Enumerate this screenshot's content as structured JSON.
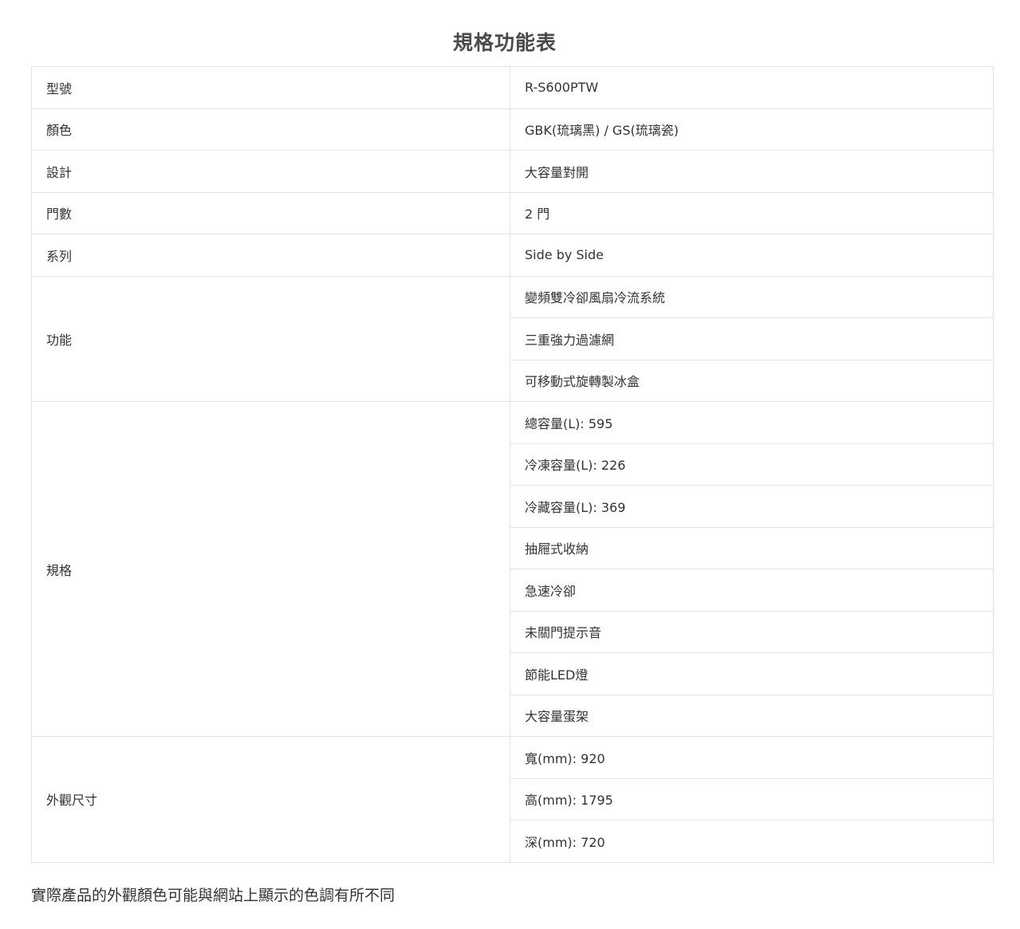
{
  "title": "規格功能表",
  "spec": {
    "model": {
      "label": "型號",
      "value": "R-S600PTW"
    },
    "color": {
      "label": "顏色",
      "value": "GBK(琉璃黑) / GS(琉璃瓷)"
    },
    "design": {
      "label": "設計",
      "value": "大容量對開"
    },
    "doors": {
      "label": "門數",
      "value": "2 門"
    },
    "series": {
      "label": "系列",
      "value": "Side by Side"
    },
    "features": {
      "label": "功能",
      "values": [
        "變頻雙冷卻風扇冷流系統",
        "三重強力過濾網",
        "可移動式旋轉製冰盒"
      ]
    },
    "specs": {
      "label": "規格",
      "values": [
        "總容量(L): 595",
        "冷凍容量(L): 226",
        "冷藏容量(L): 369",
        "抽屜式收納",
        "急速冷卻",
        "未關門提示音",
        "節能LED燈",
        "大容量蛋架"
      ]
    },
    "dimensions": {
      "label": "外觀尺寸",
      "values": [
        "寬(mm): 920",
        "高(mm): 1795",
        "深(mm): 720"
      ]
    }
  },
  "disclaimer": "實際產品的外觀顏色可能與網站上顯示的色調有所不同"
}
